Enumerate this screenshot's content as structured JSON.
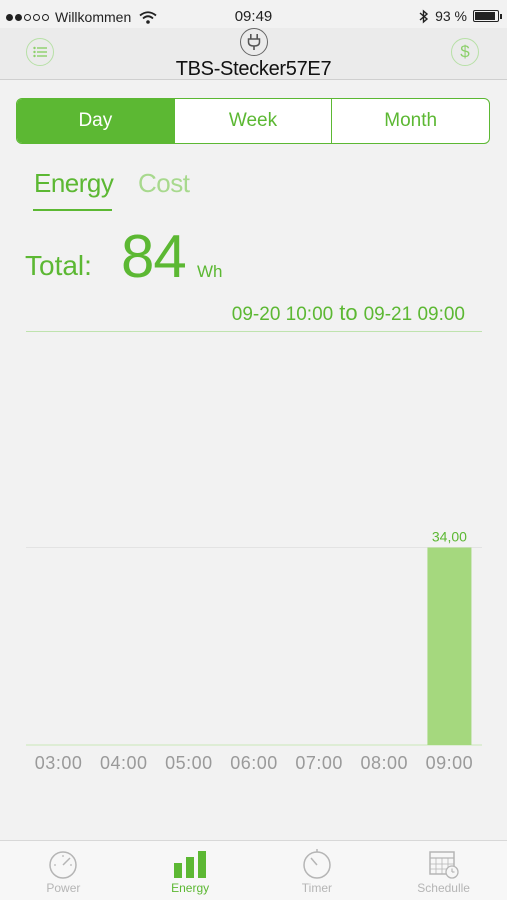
{
  "status": {
    "carrier": "Willkommen",
    "time": "09:49",
    "battery": "93 %",
    "signal_bars": 2,
    "battery_level": 0.93
  },
  "nav": {
    "title": "TBS-Stecker57E7",
    "left_icon": "list-icon",
    "right_icon": "dollar-icon",
    "center_icon": "plug-icon"
  },
  "periods": [
    "Day",
    "Week",
    "Month"
  ],
  "active_period": "Day",
  "subtabs": {
    "energy": "Energy",
    "cost": "Cost"
  },
  "total": {
    "label": "Total:",
    "value": "84",
    "unit": "Wh"
  },
  "range": {
    "from": "09-20 10:00",
    "to_word": "to",
    "to": "09-21 09:00"
  },
  "colors": {
    "accent": "#5cb833",
    "bar": "#a5d87e",
    "light": "#a8d98e"
  },
  "chart_data": {
    "type": "bar",
    "categories": [
      "03:00",
      "04:00",
      "05:00",
      "06:00",
      "07:00",
      "08:00",
      "09:00"
    ],
    "values": [
      0,
      0,
      0,
      0,
      0,
      0,
      34.0
    ],
    "value_labels": [
      "",
      "",
      "",
      "",
      "",
      "",
      "34,00"
    ],
    "ylim": [
      0,
      68
    ]
  },
  "tabbar": [
    {
      "label": "Power",
      "icon": "gauge-icon",
      "active": false
    },
    {
      "label": "Energy",
      "icon": "bar-chart-icon",
      "active": true
    },
    {
      "label": "Timer",
      "icon": "timer-icon",
      "active": false
    },
    {
      "label": "Schedulle",
      "icon": "calendar-icon",
      "active": false
    }
  ]
}
